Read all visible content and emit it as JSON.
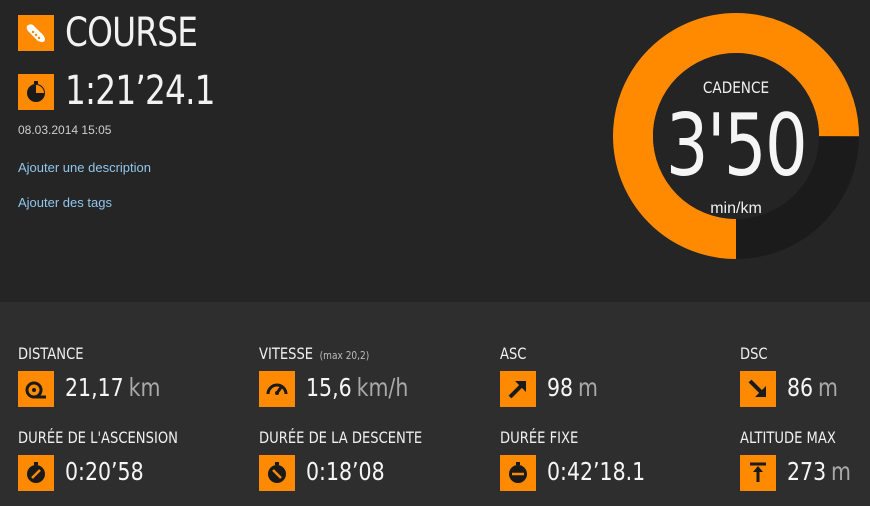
{
  "header": {
    "sport": "COURSE",
    "duration": "1:21’24.1",
    "date": "08.03.2014 15:05",
    "add_description": "Ajouter une description",
    "add_tags": "Ajouter des tags"
  },
  "gauge": {
    "label": "CADENCE",
    "value": "3'50",
    "unit": "min/km",
    "fill_fraction": 0.75,
    "color": "#ff8a00"
  },
  "stats": {
    "distance": {
      "label": "DISTANCE",
      "value": "21,17",
      "unit": "km",
      "icon": "distance-icon"
    },
    "speed": {
      "label": "VITESSE",
      "sub": "(max 20,2)",
      "value": "15,6",
      "unit": "km/h",
      "icon": "speedometer-icon"
    },
    "asc": {
      "label": "ASC",
      "value": "98",
      "unit": "m",
      "icon": "arrow-up-right-icon"
    },
    "dsc": {
      "label": "DSC",
      "value": "86",
      "unit": "m",
      "icon": "arrow-down-right-icon"
    },
    "asc_time": {
      "label": "DURÉE DE L'ASCENSION",
      "value": "0:20’58",
      "icon": "stopwatch-up-icon"
    },
    "desc_time": {
      "label": "DURÉE DE LA DESCENTE",
      "value": "0:18’08",
      "icon": "stopwatch-down-icon"
    },
    "flat_time": {
      "label": "DURÉE FIXE",
      "value": "0:42’18.1",
      "icon": "stopwatch-flat-icon"
    },
    "alt_max": {
      "label": "ALTITUDE MAX",
      "value": "273",
      "unit": "m",
      "icon": "altitude-icon"
    }
  },
  "colors": {
    "accent": "#ff8a00",
    "link": "#8fc6ec",
    "background": "#252525"
  }
}
